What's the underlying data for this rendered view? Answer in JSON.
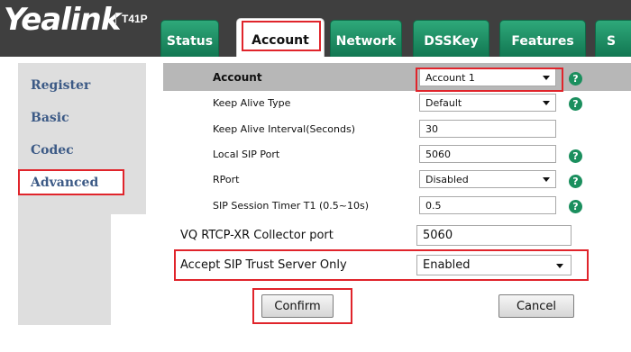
{
  "header": {
    "brand": "Yealink",
    "model": "T41P",
    "tabs": [
      {
        "label": "Status"
      },
      {
        "label": "Account"
      },
      {
        "label": "Network"
      },
      {
        "label": "DSSKey"
      },
      {
        "label": "Features"
      },
      {
        "label": "S"
      }
    ],
    "active_tab": "Account"
  },
  "sidebar": {
    "items": [
      {
        "label": "Register"
      },
      {
        "label": "Basic"
      },
      {
        "label": "Codec"
      },
      {
        "label": "Advanced"
      }
    ],
    "selected": "Advanced"
  },
  "settings": {
    "account": {
      "label": "Account",
      "value": "Account 1"
    },
    "keep_alive_type": {
      "label": "Keep Alive Type",
      "value": "Default"
    },
    "keep_alive_interval": {
      "label": "Keep Alive Interval(Seconds)",
      "value": "30"
    },
    "local_sip_port": {
      "label": "Local SIP Port",
      "value": "5060"
    },
    "rport": {
      "label": "RPort",
      "value": "Disabled"
    },
    "sip_session_timer": {
      "label": "SIP Session Timer T1 (0.5~10s)",
      "value": "0.5"
    },
    "vq_rtcp_port": {
      "label": "VQ RTCP-XR Collector port",
      "value": "5060"
    },
    "accept_sip_trust": {
      "label": "Accept SIP Trust Server Only",
      "value": "Enabled"
    }
  },
  "buttons": {
    "confirm": "Confirm",
    "cancel": "Cancel"
  },
  "help_glyph": "?",
  "colors": {
    "tab_green": "#1a8f62",
    "highlight_red": "#e0242b",
    "nav_text": "#3c5a86",
    "help_green": "#1b8f5e"
  }
}
